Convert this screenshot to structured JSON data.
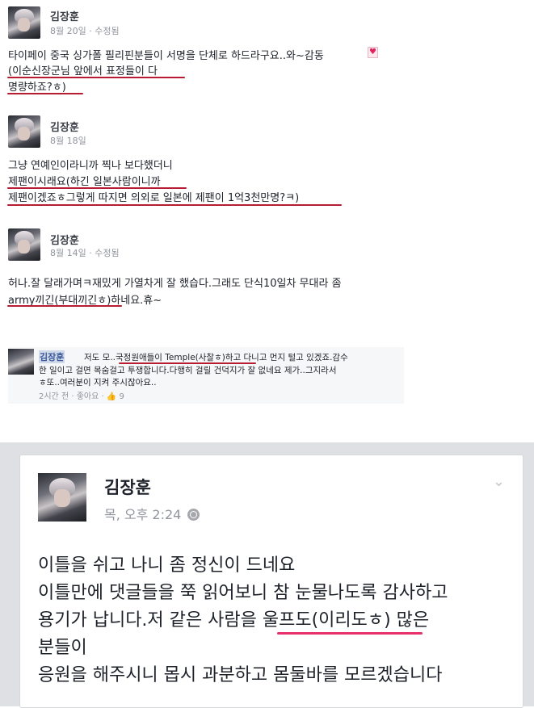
{
  "posts": [
    {
      "name": "김장훈",
      "meta": "8월 20일 · 수정됨",
      "lines": [
        "타이페이 중국 싱가폴 필리핀분들이 서명을 단체로 하드라구요..와~감동",
        "(이순신장군님 앞에서 표정들이 다",
        "명량하죠?ㅎ)"
      ]
    },
    {
      "name": "김장훈",
      "meta": "8월 18일",
      "lines": [
        "그냥 연예인이라니까 찍나 보다했더니",
        "제팬이시래요(하긴 일본사람이니까",
        "제팬이겠죠ㅎ그렇게 따지면 의외로 일본에 제팬이 1억3천만명?ㅋ)"
      ]
    },
    {
      "name": "김장훈",
      "meta": "8월 14일 · 수정됨",
      "lines": [
        "허나.잘 달래가며ㅋ재밌게 가열차게 잘 했습다.그래도 단식10일차 무대라 좀",
        "army끼긴(부대끼긴ㅎ)하네요.휴~"
      ]
    }
  ],
  "comment": {
    "name": "김장훈",
    "lines": [
      "저도 모..국정원애들이 Temple(사찰ㅎ)하고 다니고 먼지 털고 있겠죠.감수",
      "한 일이고 걸면 목숨걸고 투쟁합니다.다행히 걸릴 건덕지가 잘 없네요 제가..그지라서",
      "ㅎ또..여러분이 지켜 주시잖아요.."
    ],
    "time": "2시간 전",
    "like": "좋아요",
    "likes": "9"
  },
  "bottom_post": {
    "name": "김장훈",
    "meta": "목, 오후 2:24",
    "lines": [
      "이틀을 쉬고 나니 좀 정신이 드네요",
      "이틀만에 댓글들을 쭉 읽어보니 참 눈물나도록 감사하고",
      "용기가 납니다.저 같은 사람을 울프도(이리도ㅎ) 많은",
      "분들이",
      "응원을 해주시니 몹시 과분하고 몸둘바를 모르겠습니다"
    ]
  },
  "colors": {
    "underline_red": "#b81c33",
    "underline_pink": "#e8306a",
    "link_blue": "#3b5998"
  }
}
